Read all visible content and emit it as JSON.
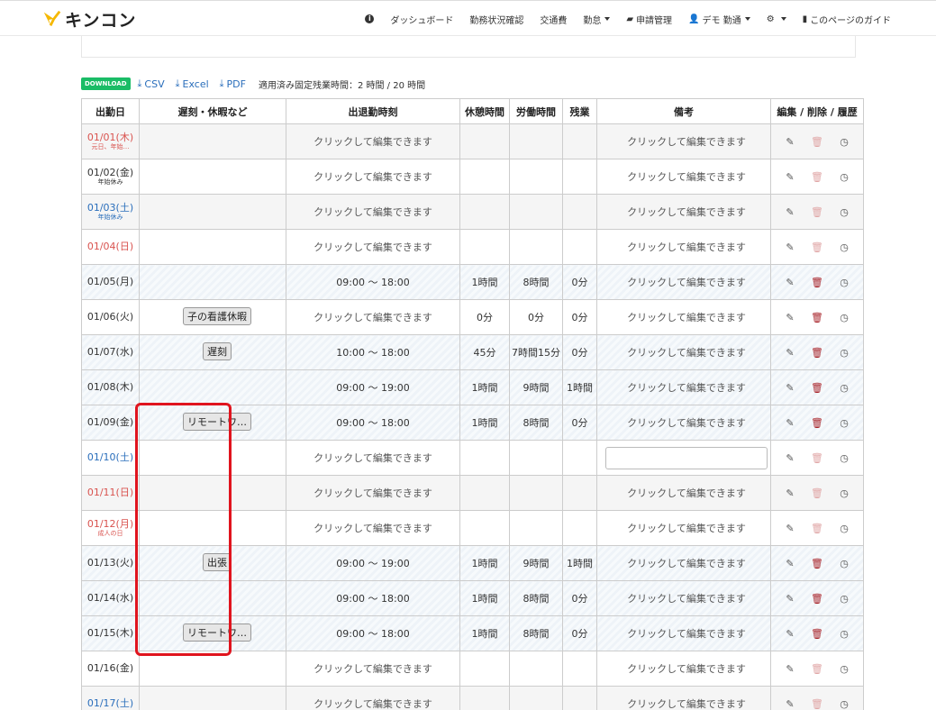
{
  "app": {
    "logo_text": "キンコン"
  },
  "nav": [
    {
      "label": "",
      "icon": "info-icon"
    },
    {
      "label": "ダッシュボード"
    },
    {
      "label": "勤務状況確認"
    },
    {
      "label": "交通費"
    },
    {
      "label": "勤怠",
      "dropdown": true
    },
    {
      "label": "申請管理",
      "icon": "folder-icon"
    },
    {
      "label": "デモ 勤通",
      "icon": "user-icon",
      "dropdown": true
    },
    {
      "label": "",
      "icon": "gear-icon",
      "dropdown": true
    },
    {
      "label": "このページのガイド",
      "icon": "book-icon"
    }
  ],
  "toolbar": {
    "download_badge": "DOWNLOAD",
    "csv": "CSV",
    "excel": "Excel",
    "pdf": "PDF",
    "fixed_overtime_label": "適用済み固定残業時間：2 時間 / 20 時間"
  },
  "table": {
    "headers": [
      "出勤日",
      "遅刻・休暇など",
      "出退勤時刻",
      "休憩時間",
      "労働時間",
      "残業",
      "備考",
      "編集 / 削除 / 履歴"
    ],
    "placeholder": "クリックして編集できます",
    "rows": [
      {
        "date": "01/01(木)",
        "sub": "元日、年始…",
        "day": "sun",
        "kind": "",
        "time": "",
        "break": "",
        "work": "",
        "ot": "",
        "memo": "クリックして編集できます",
        "style": "gray",
        "trash": "off"
      },
      {
        "date": "01/02(金)",
        "sub": "年始休み",
        "day": "",
        "kind": "",
        "time": "",
        "break": "",
        "work": "",
        "ot": "",
        "memo": "クリックして編集できます",
        "style": "",
        "trash": "off"
      },
      {
        "date": "01/03(土)",
        "sub": "年始休み",
        "day": "sat",
        "kind": "",
        "time": "",
        "break": "",
        "work": "",
        "ot": "",
        "memo": "クリックして編集できます",
        "style": "gray",
        "trash": "off"
      },
      {
        "date": "01/04(日)",
        "sub": "",
        "day": "sun",
        "kind": "",
        "time": "",
        "break": "",
        "work": "",
        "ot": "",
        "memo": "クリックして編集できます",
        "style": "",
        "trash": "off"
      },
      {
        "date": "01/05(月)",
        "sub": "",
        "day": "",
        "kind": "",
        "time": "09:00 ～ 18:00",
        "break": "1時間",
        "work": "8時間",
        "ot": "0分",
        "memo": "クリックして編集できます",
        "style": "hatch",
        "trash": "on"
      },
      {
        "date": "01/06(火)",
        "sub": "",
        "day": "",
        "kind": "子の看護休暇",
        "time": "",
        "break": "0分",
        "work": "0分",
        "ot": "0分",
        "memo": "クリックして編集できます",
        "style": "",
        "trash": "on"
      },
      {
        "date": "01/07(水)",
        "sub": "",
        "day": "",
        "kind": "遅刻",
        "time": "10:00 ～ 18:00",
        "break": "45分",
        "work": "7時間15分",
        "ot": "0分",
        "memo": "クリックして編集できます",
        "style": "hatch",
        "trash": "on"
      },
      {
        "date": "01/08(木)",
        "sub": "",
        "day": "",
        "kind": "",
        "time": "09:00 ～ 19:00",
        "break": "1時間",
        "work": "9時間",
        "ot": "1時間",
        "memo": "クリックして編集できます",
        "style": "hatch",
        "trash": "on"
      },
      {
        "date": "01/09(金)",
        "sub": "",
        "day": "",
        "kind": "リモートワ…",
        "time": "09:00 ～ 18:00",
        "break": "1時間",
        "work": "8時間",
        "ot": "0分",
        "memo": "クリックして編集できます",
        "style": "hatch",
        "trash": "on"
      },
      {
        "date": "01/10(土)",
        "sub": "",
        "day": "sat",
        "kind": "",
        "time": "",
        "break": "",
        "work": "",
        "ot": "",
        "memo": "",
        "memo_input": true,
        "style": "",
        "trash": "off"
      },
      {
        "date": "01/11(日)",
        "sub": "",
        "day": "sun",
        "kind": "",
        "time": "",
        "break": "",
        "work": "",
        "ot": "",
        "memo": "クリックして編集できます",
        "style": "gray",
        "trash": "off"
      },
      {
        "date": "01/12(月)",
        "sub": "成人の日",
        "day": "sun",
        "kind": "",
        "time": "",
        "break": "",
        "work": "",
        "ot": "",
        "memo": "クリックして編集できます",
        "style": "",
        "trash": "off"
      },
      {
        "date": "01/13(火)",
        "sub": "",
        "day": "",
        "kind": "出張",
        "time": "09:00 ～ 19:00",
        "break": "1時間",
        "work": "9時間",
        "ot": "1時間",
        "memo": "クリックして編集できます",
        "style": "hatch",
        "trash": "on"
      },
      {
        "date": "01/14(水)",
        "sub": "",
        "day": "",
        "kind": "",
        "time": "09:00 ～ 18:00",
        "break": "1時間",
        "work": "8時間",
        "ot": "0分",
        "memo": "クリックして編集できます",
        "style": "hatch",
        "trash": "on"
      },
      {
        "date": "01/15(木)",
        "sub": "",
        "day": "",
        "kind": "リモートワ…",
        "time": "09:00 ～ 18:00",
        "break": "1時間",
        "work": "8時間",
        "ot": "0分",
        "memo": "クリックして編集できます",
        "style": "hatch",
        "trash": "on"
      },
      {
        "date": "01/16(金)",
        "sub": "",
        "day": "",
        "kind": "",
        "time": "",
        "break": "",
        "work": "",
        "ot": "",
        "memo": "クリックして編集できます",
        "style": "",
        "trash": "off"
      },
      {
        "date": "01/17(土)",
        "sub": "",
        "day": "sat",
        "kind": "",
        "time": "",
        "break": "",
        "work": "",
        "ot": "",
        "memo": "クリックして編集できます",
        "style": "gray",
        "trash": "off"
      }
    ]
  },
  "colors": {
    "accent_green": "#1abc66",
    "link_blue": "#2a6ebb",
    "holiday_red": "#d9534f",
    "highlight_red": "#e0141e"
  }
}
